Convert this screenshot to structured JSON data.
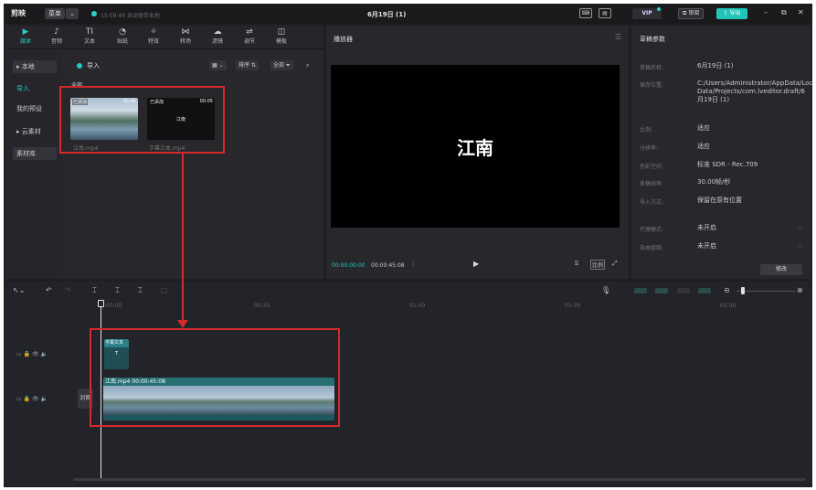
{
  "titlebar": {
    "app_name": "剪映",
    "menu": "菜单",
    "autosave": "15:09:49 自动保存本地",
    "doc_title": "6月19日 (1)",
    "vip": "VIP",
    "review": "审阅",
    "export": "导出"
  },
  "media_tabs": [
    {
      "icon": "▶",
      "label": "媒体"
    },
    {
      "icon": "♪",
      "label": "音频"
    },
    {
      "icon": "TI",
      "label": "文本"
    },
    {
      "icon": "◔",
      "label": "贴纸"
    },
    {
      "icon": "✧",
      "label": "特效"
    },
    {
      "icon": "⋈",
      "label": "转场"
    },
    {
      "icon": "☁",
      "label": "滤镜"
    },
    {
      "icon": "⇌",
      "label": "调节"
    },
    {
      "icon": "◫",
      "label": "模板"
    }
  ],
  "side_nav": {
    "local": "▸ 本地",
    "import": "导入",
    "my_presets": "我的预设",
    "cloud": "▸ 云素材",
    "library": "素材库"
  },
  "media": {
    "import_label": "导入",
    "view_btn": "▦ ⌄",
    "sort_btn": "排序 ⇅",
    "all_btn": "全部 ⏷",
    "all_label": "全部",
    "clips": [
      {
        "name": "江南.mp4",
        "added": "已添加",
        "duration": "00:45"
      },
      {
        "name": "字幕文本.mp4",
        "added": "已添加",
        "duration": "00:05",
        "thumb_text": "江南"
      }
    ]
  },
  "player": {
    "title": "播放器",
    "screen_text": "江南",
    "current_time": "00:00:00:00",
    "total_time": "00:00:45:08",
    "ratio": "比例"
  },
  "props": {
    "title": "草稿参数",
    "rows": [
      {
        "k": "草稿名称:",
        "v": "6月19日 (1)"
      },
      {
        "k": "保存位置:",
        "v": "C:/Users/Administrator/AppData/Local/JianyingPro/User Data/Projects/com.lveditor.draft/6月19日 (1)"
      },
      {
        "k": "比例:",
        "v": "适应"
      },
      {
        "k": "分辨率:",
        "v": "适应"
      },
      {
        "k": "色彩空间:",
        "v": "标准 SDR - Rec.709"
      },
      {
        "k": "草稿帧率:",
        "v": "30.00帧/秒"
      },
      {
        "k": "导入方式:",
        "v": "保留在原有位置"
      },
      {
        "k": "代理模式:",
        "v": "未开启"
      },
      {
        "k": "自由层级:",
        "v": "未开启"
      }
    ],
    "modify": "修改"
  },
  "timeline": {
    "ruler": [
      "00:00",
      "00:30",
      "01:00",
      "01:30",
      "02:00"
    ],
    "cover": "封面",
    "text_clip": "字幕文本",
    "video_clip": "江南.mp4  00:00:45:08"
  },
  "colors": {
    "accent": "#27c8bd",
    "highlight": "#d42a2a"
  }
}
